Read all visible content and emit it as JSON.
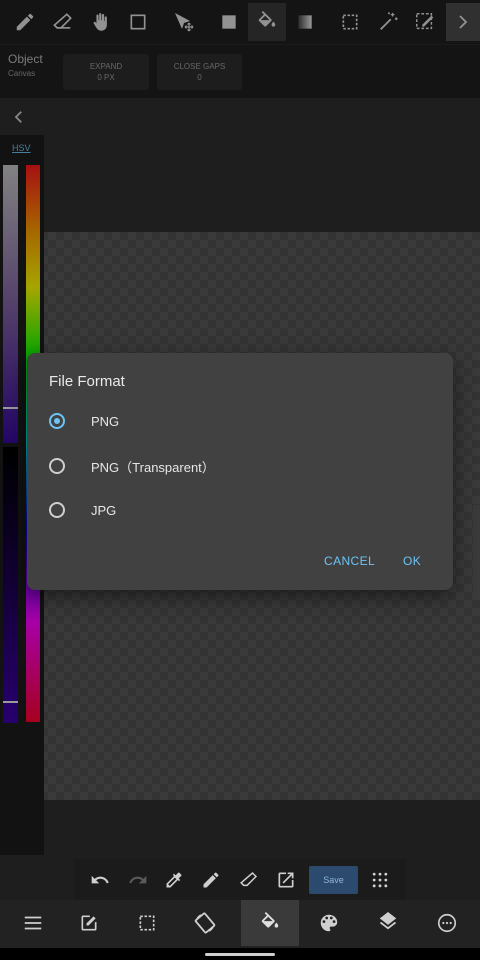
{
  "toolbar": {
    "tools": [
      "pencil-icon",
      "eraser-icon",
      "hand-icon",
      "shape-icon",
      "move-icon",
      "fill-rect-icon",
      "bucket-icon",
      "gradient-icon",
      "selection-icon",
      "magic-wand-icon",
      "edit-selection-icon",
      "more-icon"
    ],
    "active_tool": "bucket-icon"
  },
  "options": {
    "layer_label": "Object",
    "layer_sub": "Canvas",
    "expand_label": "EXPAND",
    "expand_value": "0 PX",
    "closegaps_label": "CLOSE GAPS",
    "closegaps_value": "0"
  },
  "colorpanel": {
    "mode": "HSV"
  },
  "dialog": {
    "title": "File Format",
    "options": [
      {
        "label": "PNG",
        "selected": true
      },
      {
        "label": "PNG（Transparent）",
        "selected": false
      },
      {
        "label": "JPG",
        "selected": false
      }
    ],
    "cancel": "CANCEL",
    "ok": "OK"
  },
  "actionbar": {
    "save_label": "Save"
  },
  "colors": {
    "accent": "#6cc4f5",
    "dialog_bg": "#414141",
    "toolbar_bg": "#1f1f1f"
  }
}
